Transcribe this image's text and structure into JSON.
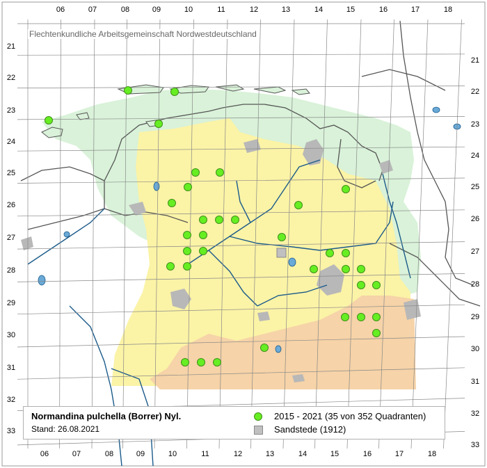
{
  "credit": "Flechtenkundliche Arbeitsgemeinschaft Nordwestdeutschland",
  "grid": {
    "col_labels": [
      "06",
      "07",
      "08",
      "09",
      "10",
      "11",
      "12",
      "13",
      "14",
      "15",
      "16",
      "17",
      "18"
    ],
    "row_labels": [
      "21",
      "22",
      "23",
      "24",
      "25",
      "26",
      "27",
      "28",
      "29",
      "30",
      "31",
      "32",
      "33"
    ]
  },
  "legend": {
    "species": "Normandina pulchella (Borrer) Nyl.",
    "date": "Stand: 26.08.2021",
    "recent_label": "2015 - 2021 (35 von 352 Quadranten)",
    "historic_label": "Sandstede (1912)"
  },
  "colors": {
    "recent_dot": "#66ee22",
    "historic_square": "#c0c0c0",
    "coastal_zone": "#d9f2d9",
    "inland_zone": "#fbf3a6",
    "southern_zone": "#f6d3a8",
    "rivers": "#1a5a8a",
    "coastline": "#555555",
    "towns": "#b8b8b8"
  },
  "records": {
    "recent": [
      {
        "cell": "0623",
        "label": ""
      },
      {
        "cell": "0822",
        "label": ""
      },
      {
        "cell": "0922",
        "label": ""
      },
      {
        "cell": "0923",
        "label": ""
      },
      {
        "cell": "1024",
        "label": ""
      },
      {
        "cell": "1124",
        "label": ""
      },
      {
        "cell": "1025",
        "label": ""
      },
      {
        "cell": "0925",
        "label": ""
      },
      {
        "cell": "1126",
        "label": ""
      },
      {
        "cell": "1126b",
        "label": ""
      },
      {
        "cell": "1226",
        "label": ""
      },
      {
        "cell": "1026",
        "label": ""
      },
      {
        "cell": "1126c",
        "label": ""
      },
      {
        "cell": "1027",
        "label": ""
      },
      {
        "cell": "1127",
        "label": ""
      },
      {
        "cell": "0927",
        "label": ""
      },
      {
        "cell": "1027b",
        "label": ""
      },
      {
        "cell": "1325",
        "label": ""
      },
      {
        "cell": "1524",
        "label": ""
      },
      {
        "cell": "1326",
        "label": ""
      },
      {
        "cell": "1427",
        "label": ""
      },
      {
        "cell": "1527",
        "label": ""
      },
      {
        "cell": "1527b",
        "label": ""
      },
      {
        "cell": "1627",
        "label": ""
      },
      {
        "cell": "1527c",
        "label": ""
      },
      {
        "cell": "1628",
        "label": ""
      },
      {
        "cell": "1628b",
        "label": ""
      },
      {
        "cell": "1529",
        "label": ""
      },
      {
        "cell": "1629",
        "label": ""
      },
      {
        "cell": "1629b",
        "label": ""
      },
      {
        "cell": "1629c",
        "label": ""
      },
      {
        "cell": "1230",
        "label": ""
      },
      {
        "cell": "1030",
        "label": ""
      },
      {
        "cell": "1130",
        "label": ""
      },
      {
        "cell": "1130b",
        "label": ""
      }
    ],
    "historic": [
      {
        "cell": "1327"
      }
    ]
  }
}
